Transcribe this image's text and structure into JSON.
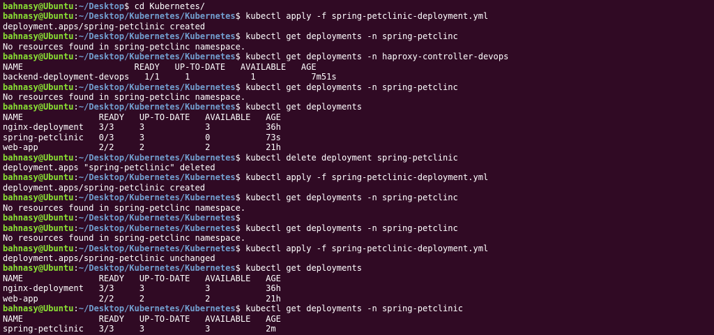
{
  "terminal": {
    "colors": {
      "background": "#300a24",
      "user": "#8ae234",
      "path": "#729fcf",
      "text": "#ffffff"
    },
    "lines": [
      {
        "type": "prompt",
        "user": "bahnasy@Ubuntu",
        "sep": ":",
        "path": "~/Desktop",
        "suffix": "$ ",
        "cmd": "cd Kubernetes/"
      },
      {
        "type": "prompt",
        "user": "bahnasy@Ubuntu",
        "sep": ":",
        "path": "~/Desktop/Kubernetes/Kubernetes",
        "suffix": "$ ",
        "cmd": "kubectl apply -f spring-petclinic-deployment.yml"
      },
      {
        "type": "output",
        "text": "deployment.apps/spring-petclinic created"
      },
      {
        "type": "prompt",
        "user": "bahnasy@Ubuntu",
        "sep": ":",
        "path": "~/Desktop/Kubernetes/Kubernetes",
        "suffix": "$ ",
        "cmd": "kubectl get deployments -n spring-petclinc"
      },
      {
        "type": "output",
        "text": "No resources found in spring-petclinc namespace."
      },
      {
        "type": "prompt",
        "user": "bahnasy@Ubuntu",
        "sep": ":",
        "path": "~/Desktop/Kubernetes/Kubernetes",
        "suffix": "$ ",
        "cmd": "kubectl get deployments -n haproxy-controller-devops"
      },
      {
        "type": "output",
        "text": "NAME                      READY   UP-TO-DATE   AVAILABLE   AGE"
      },
      {
        "type": "output",
        "text": "backend-deployment-devops   1/1     1            1           7m51s"
      },
      {
        "type": "prompt",
        "user": "bahnasy@Ubuntu",
        "sep": ":",
        "path": "~/Desktop/Kubernetes/Kubernetes",
        "suffix": "$ ",
        "cmd": "kubectl get deployments -n spring-petclinc"
      },
      {
        "type": "output",
        "text": "No resources found in spring-petclinc namespace."
      },
      {
        "type": "prompt",
        "user": "bahnasy@Ubuntu",
        "sep": ":",
        "path": "~/Desktop/Kubernetes/Kubernetes",
        "suffix": "$ ",
        "cmd": "kubectl get deployments"
      },
      {
        "type": "output",
        "text": "NAME               READY   UP-TO-DATE   AVAILABLE   AGE"
      },
      {
        "type": "output",
        "text": "nginx-deployment   3/3     3            3           36h"
      },
      {
        "type": "output",
        "text": "spring-petclinic   0/3     3            0           73s"
      },
      {
        "type": "output",
        "text": "web-app            2/2     2            2           21h"
      },
      {
        "type": "prompt",
        "user": "bahnasy@Ubuntu",
        "sep": ":",
        "path": "~/Desktop/Kubernetes/Kubernetes",
        "suffix": "$ ",
        "cmd": "kubectl delete deployment spring-petclinic"
      },
      {
        "type": "output",
        "text": "deployment.apps \"spring-petclinic\" deleted"
      },
      {
        "type": "prompt",
        "user": "bahnasy@Ubuntu",
        "sep": ":",
        "path": "~/Desktop/Kubernetes/Kubernetes",
        "suffix": "$ ",
        "cmd": "kubectl apply -f spring-petclinic-deployment.yml"
      },
      {
        "type": "output",
        "text": "deployment.apps/spring-petclinic created"
      },
      {
        "type": "prompt",
        "user": "bahnasy@Ubuntu",
        "sep": ":",
        "path": "~/Desktop/Kubernetes/Kubernetes",
        "suffix": "$ ",
        "cmd": "kubectl get deployments -n spring-petclinc"
      },
      {
        "type": "output",
        "text": "No resources found in spring-petclinc namespace."
      },
      {
        "type": "prompt",
        "user": "bahnasy@Ubuntu",
        "sep": ":",
        "path": "~/Desktop/Kubernetes/Kubernetes",
        "suffix": "$",
        "cmd": ""
      },
      {
        "type": "prompt",
        "user": "bahnasy@Ubuntu",
        "sep": ":",
        "path": "~/Desktop/Kubernetes/Kubernetes",
        "suffix": "$ ",
        "cmd": "kubectl get deployments -n spring-petclinc"
      },
      {
        "type": "output",
        "text": "No resources found in spring-petclinc namespace."
      },
      {
        "type": "prompt",
        "user": "bahnasy@Ubuntu",
        "sep": ":",
        "path": "~/Desktop/Kubernetes/Kubernetes",
        "suffix": "$ ",
        "cmd": "kubectl apply -f spring-petclinic-deployment.yml"
      },
      {
        "type": "output",
        "text": "deployment.apps/spring-petclinic unchanged"
      },
      {
        "type": "prompt",
        "user": "bahnasy@Ubuntu",
        "sep": ":",
        "path": "~/Desktop/Kubernetes/Kubernetes",
        "suffix": "$ ",
        "cmd": "kubectl get deployments"
      },
      {
        "type": "output",
        "text": "NAME               READY   UP-TO-DATE   AVAILABLE   AGE"
      },
      {
        "type": "output",
        "text": "nginx-deployment   3/3     3            3           36h"
      },
      {
        "type": "output",
        "text": "web-app            2/2     2            2           21h"
      },
      {
        "type": "prompt",
        "user": "bahnasy@Ubuntu",
        "sep": ":",
        "path": "~/Desktop/Kubernetes/Kubernetes",
        "suffix": "$ ",
        "cmd": "kubectl get deployments -n spring-petclinic"
      },
      {
        "type": "output",
        "text": "NAME               READY   UP-TO-DATE   AVAILABLE   AGE"
      },
      {
        "type": "output",
        "text": "spring-petclinic   3/3     3            3           2m"
      }
    ]
  }
}
